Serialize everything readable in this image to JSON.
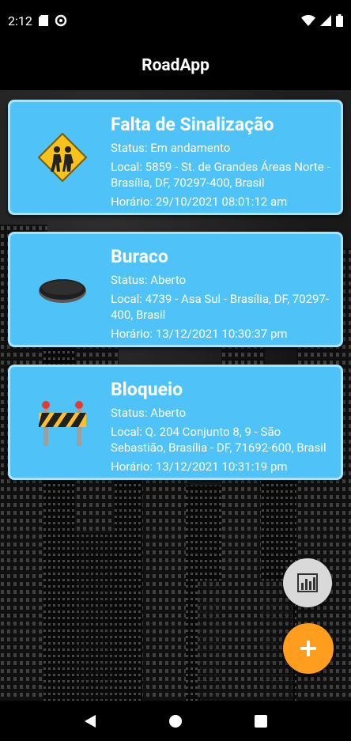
{
  "status_bar": {
    "time": "2:12",
    "icons": [
      "sd-card-icon",
      "sync-icon",
      "wifi-icon",
      "signal-icon",
      "battery-icon"
    ]
  },
  "app": {
    "title": "RoadApp"
  },
  "reports": [
    {
      "title": "Falta de Sinalização",
      "status": "Status: Em andamento",
      "location": "Local: 5859 - St. de Grandes Áreas Norte - Brasília, DF, 70297-400, Brasil",
      "time": "Horário: 29/10/2021 08:01:12 am",
      "icon": "children-crossing-sign-icon"
    },
    {
      "title": "Buraco",
      "status": "Status: Aberto",
      "location": "Local: 4739 - Asa Sul - Brasília, DF, 70297-400, Brasil",
      "time": "Horário: 13/12/2021 10:30:37 pm",
      "icon": "pothole-icon"
    },
    {
      "title": "Bloqueio",
      "status": "Status: Aberto",
      "location": "Local: Q. 204 Conjunto 8, 9 - São Sebastião, Brasília - DF, 71692-600, Brasil",
      "time": "Horário: 13/12/2021 10:31:19 pm",
      "icon": "roadblock-barrier-icon"
    }
  ],
  "fab": {
    "chart_icon": "bar-chart-icon",
    "add_icon": "plus-icon"
  },
  "colors": {
    "card": "#4fc3f7",
    "card_border": "#a7e4ff",
    "fab_add": "#ff9d1e",
    "fab_chart": "#d9d9d9"
  },
  "nav": [
    "back-icon",
    "home-icon",
    "recents-icon"
  ]
}
